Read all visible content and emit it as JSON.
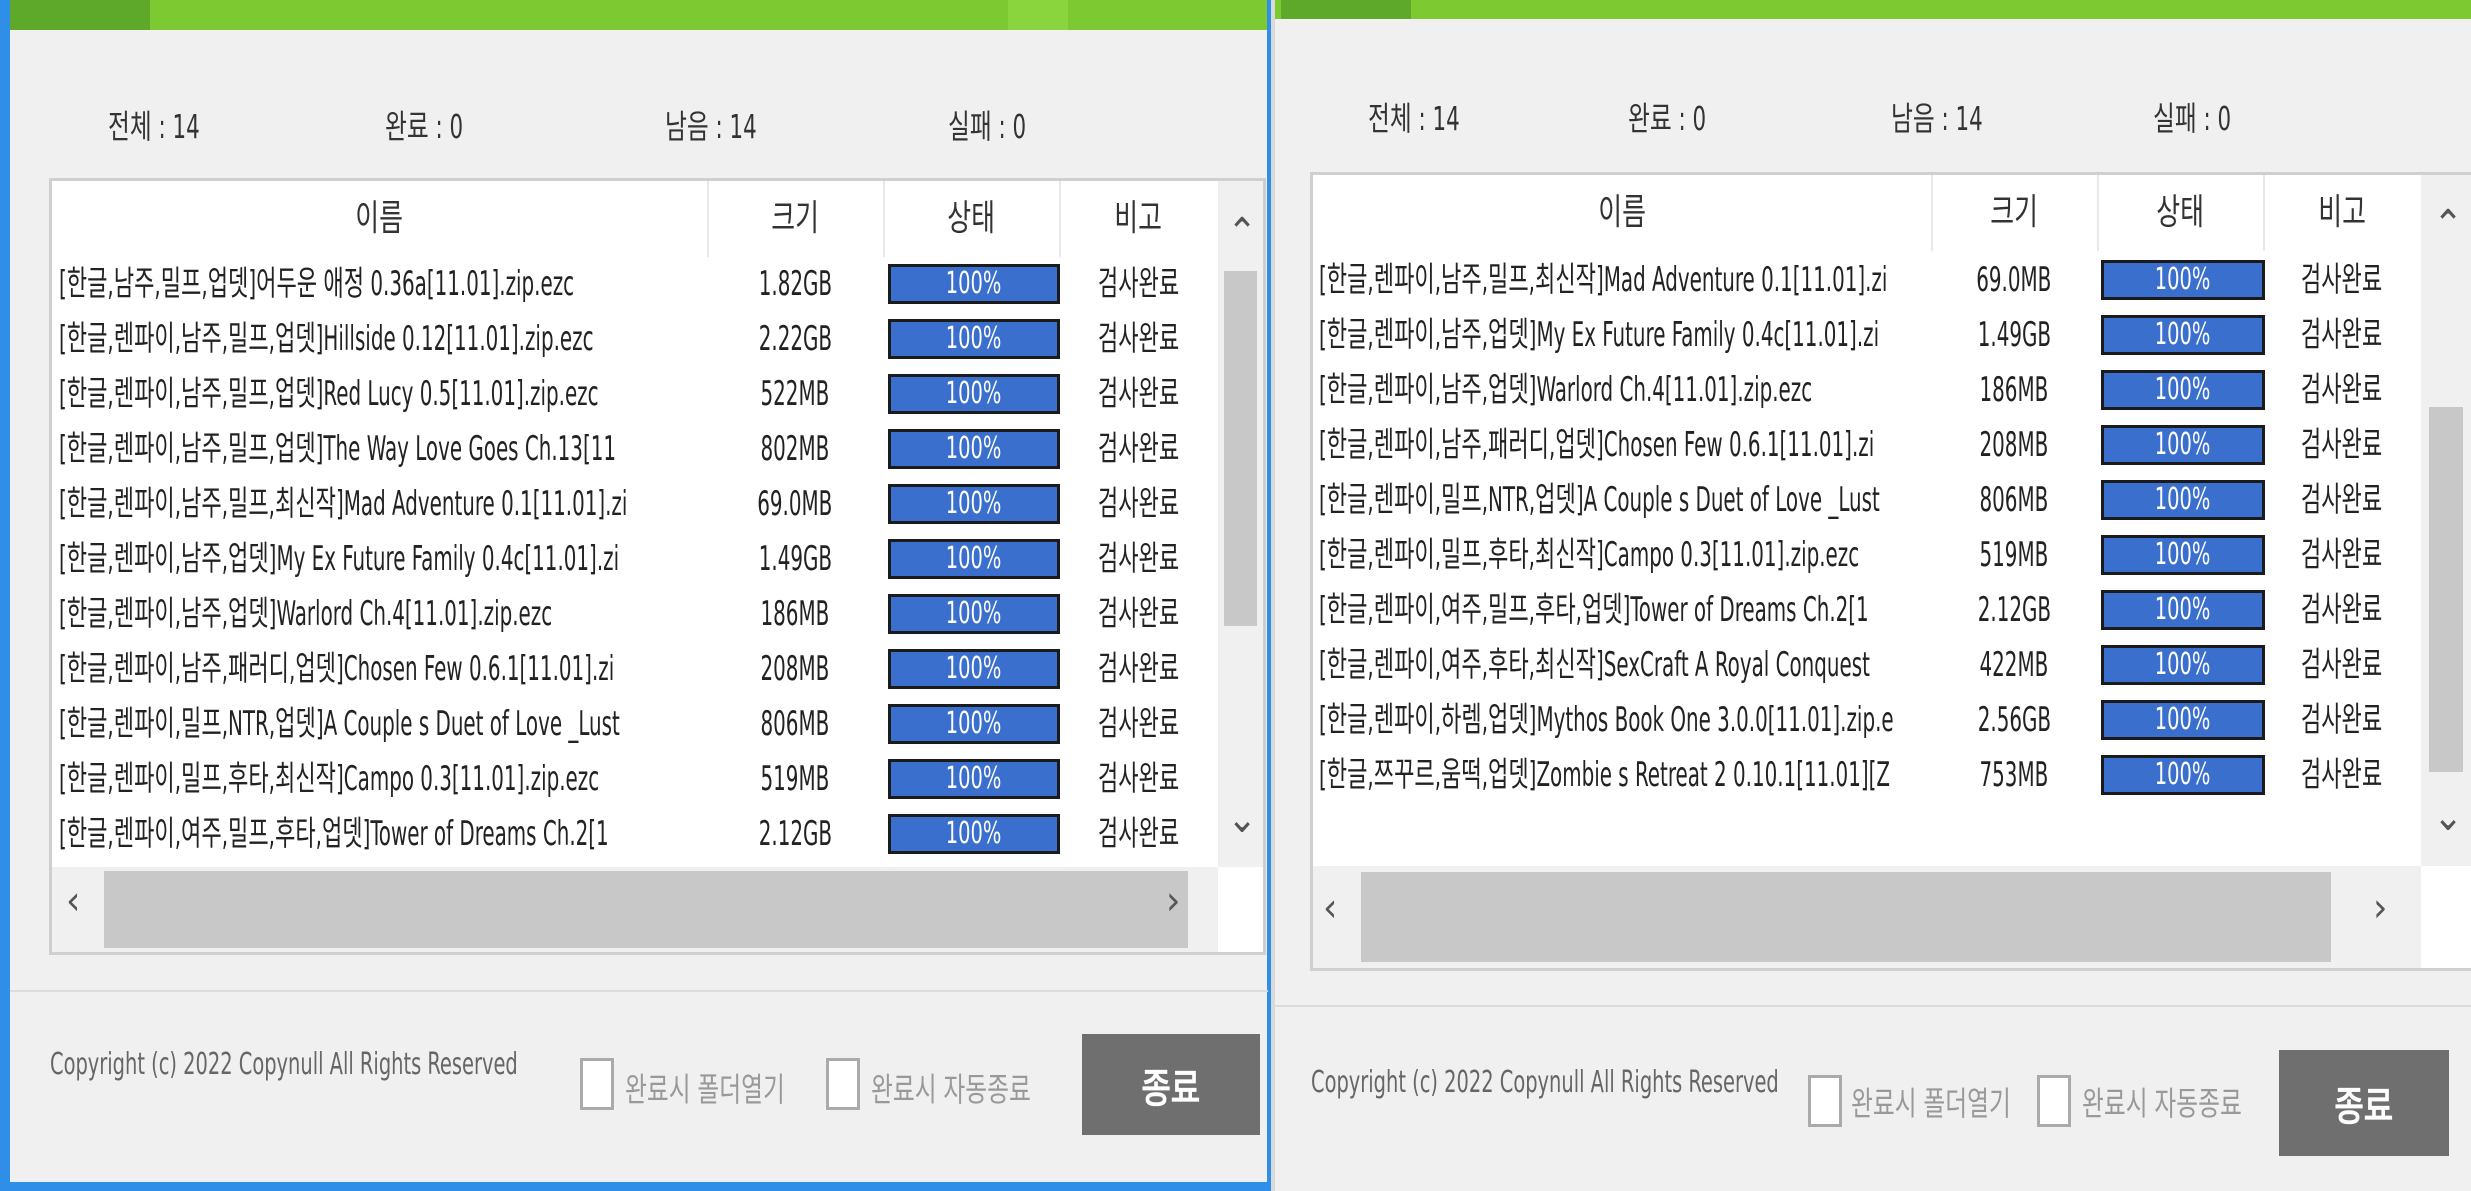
{
  "left": {
    "stats": {
      "total": "전체 : 14",
      "done": "완료 : 0",
      "remaining": "남음 : 14",
      "failed": "실패 : 0"
    },
    "columns": {
      "name": "이름",
      "size": "크기",
      "status": "상태",
      "note": "비고"
    },
    "rows": [
      {
        "name": "[한글,남주,밀프,업뎃]어두운 애정 0.36a[11.01].zip.ezc",
        "size": "1.82GB",
        "progress": "100%",
        "note": "검사완료"
      },
      {
        "name": "[한글,렌파이,남주,밀프,업뎃]Hillside 0.12[11.01].zip.ezc",
        "size": "2.22GB",
        "progress": "100%",
        "note": "검사완료"
      },
      {
        "name": "[한글,렌파이,남주,밀프,업뎃]Red Lucy 0.5[11.01].zip.ezc",
        "size": "522MB",
        "progress": "100%",
        "note": "검사완료"
      },
      {
        "name": "[한글,렌파이,남주,밀프,업뎃]The Way Love Goes Ch.13[11",
        "size": "802MB",
        "progress": "100%",
        "note": "검사완료"
      },
      {
        "name": "[한글,렌파이,남주,밀프,최신작]Mad Adventure 0.1[11.01].zi",
        "size": "69.0MB",
        "progress": "100%",
        "note": "검사완료"
      },
      {
        "name": "[한글,렌파이,남주,업뎃]My Ex Future Family 0.4c[11.01].zi",
        "size": "1.49GB",
        "progress": "100%",
        "note": "검사완료"
      },
      {
        "name": "[한글,렌파이,남주,업뎃]Warlord Ch.4[11.01].zip.ezc",
        "size": "186MB",
        "progress": "100%",
        "note": "검사완료"
      },
      {
        "name": "[한글,렌파이,남주,패러디,업뎃]Chosen Few 0.6.1[11.01].zi",
        "size": "208MB",
        "progress": "100%",
        "note": "검사완료"
      },
      {
        "name": "[한글,렌파이,밀프,NTR,업뎃]A Couple s Duet of Love _Lust",
        "size": "806MB",
        "progress": "100%",
        "note": "검사완료"
      },
      {
        "name": "[한글,렌파이,밀프,후타,최신작]Campo 0.3[11.01].zip.ezc",
        "size": "519MB",
        "progress": "100%",
        "note": "검사완료"
      },
      {
        "name": "[한글,렌파이,여주,밀프,후타,업뎃]Tower of Dreams Ch.2[1",
        "size": "2.12GB",
        "progress": "100%",
        "note": "검사완료"
      }
    ],
    "footer": {
      "copyright": "Copyright (c) 2022 Copynull All Rights Reserved",
      "open_folder": "완료시 폴더열기",
      "auto_exit": "완료시 자동종료",
      "exit": "종료"
    }
  },
  "right": {
    "stats": {
      "total": "전체 : 14",
      "done": "완료 : 0",
      "remaining": "남음 : 14",
      "failed": "실패 : 0"
    },
    "columns": {
      "name": "이름",
      "size": "크기",
      "status": "상태",
      "note": "비고"
    },
    "rows": [
      {
        "name": "[한글,렌파이,남주,밀프,최신작]Mad Adventure 0.1[11.01].zi",
        "size": "69.0MB",
        "progress": "100%",
        "note": "검사완료"
      },
      {
        "name": "[한글,렌파이,남주,업뎃]My Ex Future Family 0.4c[11.01].zi",
        "size": "1.49GB",
        "progress": "100%",
        "note": "검사완료"
      },
      {
        "name": "[한글,렌파이,남주,업뎃]Warlord Ch.4[11.01].zip.ezc",
        "size": "186MB",
        "progress": "100%",
        "note": "검사완료"
      },
      {
        "name": "[한글,렌파이,남주,패러디,업뎃]Chosen Few 0.6.1[11.01].zi",
        "size": "208MB",
        "progress": "100%",
        "note": "검사완료"
      },
      {
        "name": "[한글,렌파이,밀프,NTR,업뎃]A Couple s Duet of Love _Lust",
        "size": "806MB",
        "progress": "100%",
        "note": "검사완료"
      },
      {
        "name": "[한글,렌파이,밀프,후타,최신작]Campo 0.3[11.01].zip.ezc",
        "size": "519MB",
        "progress": "100%",
        "note": "검사완료"
      },
      {
        "name": "[한글,렌파이,여주,밀프,후타,업뎃]Tower of Dreams Ch.2[1",
        "size": "2.12GB",
        "progress": "100%",
        "note": "검사완료"
      },
      {
        "name": "[한글,렌파이,여주,후타,최신작]SexCraft A Royal Conquest",
        "size": "422MB",
        "progress": "100%",
        "note": "검사완료"
      },
      {
        "name": "[한글,렌파이,하렘,업뎃]Mythos Book One 3.0.0[11.01].zip.e",
        "size": "2.56GB",
        "progress": "100%",
        "note": "검사완료"
      },
      {
        "name": "[한글,쯔꾸르,움떡,업뎃]Zombie s Retreat 2 0.10.1[11.01][Z",
        "size": "753MB",
        "progress": "100%",
        "note": "검사완료"
      }
    ],
    "footer": {
      "copyright": "Copyright (c) 2022 Copynull All Rights Reserved",
      "open_folder": "완료시 폴더열기",
      "auto_exit": "완료시 자동종료",
      "exit": "종료"
    }
  },
  "icons": {
    "scroll_up": "chevron-up-icon",
    "scroll_down": "chevron-down-icon",
    "scroll_left": "chevron-left-icon",
    "scroll_right": "chevron-right-icon"
  },
  "colors": {
    "title_bar": "#7cc932",
    "progress_fill": "#3a6fce",
    "exit_button": "#6f6f6f",
    "window_border": "#2f8ee8"
  }
}
